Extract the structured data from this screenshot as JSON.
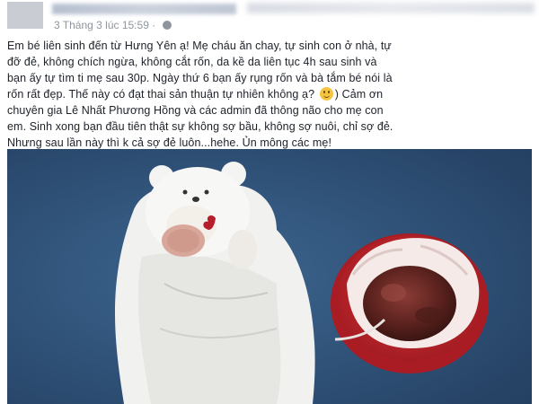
{
  "post": {
    "timestamp": "3 Tháng 3 lúc 15:59",
    "body_lines": [
      "Em bé liên sinh đến từ Hưng Yên ạ! Mẹ cháu ăn chay, tự sinh con ở nhà, tự",
      "đỡ đẻ, không chích ngừa, không cắt rốn, da kề da liên tục 4h sau sinh và",
      "bạn ấy tự tìm ti mẹ sau 30p. Ngày thứ 6 bạn ấy rụng rốn và bà tắm bé nói là",
      "rốn rất đẹp. Thế này có đạt thai sản thuận tự nhiên không ạ?",
      ") Cảm ơn",
      "chuyên gia Lê Nhất Phương Hồng và các admin đã thông não cho mẹ con",
      "em. Sinh xong bạn đầu tiên thật sự không sợ bầu, không sợ nuôi, chỉ sợ đẻ.",
      "Nhưng sau lần này thì k cả sợ đẻ luôn...hehe. Ủn mông các mẹ!"
    ],
    "emoji": "smile-emoji"
  },
  "photo": {
    "subject": "baby-in-bear-hood-blanket-with-placenta-bowl"
  },
  "colors": {
    "text": "#1d2129",
    "meta": "#90949c",
    "blanket": "#2d4f76",
    "bowl": "#c9252d"
  }
}
